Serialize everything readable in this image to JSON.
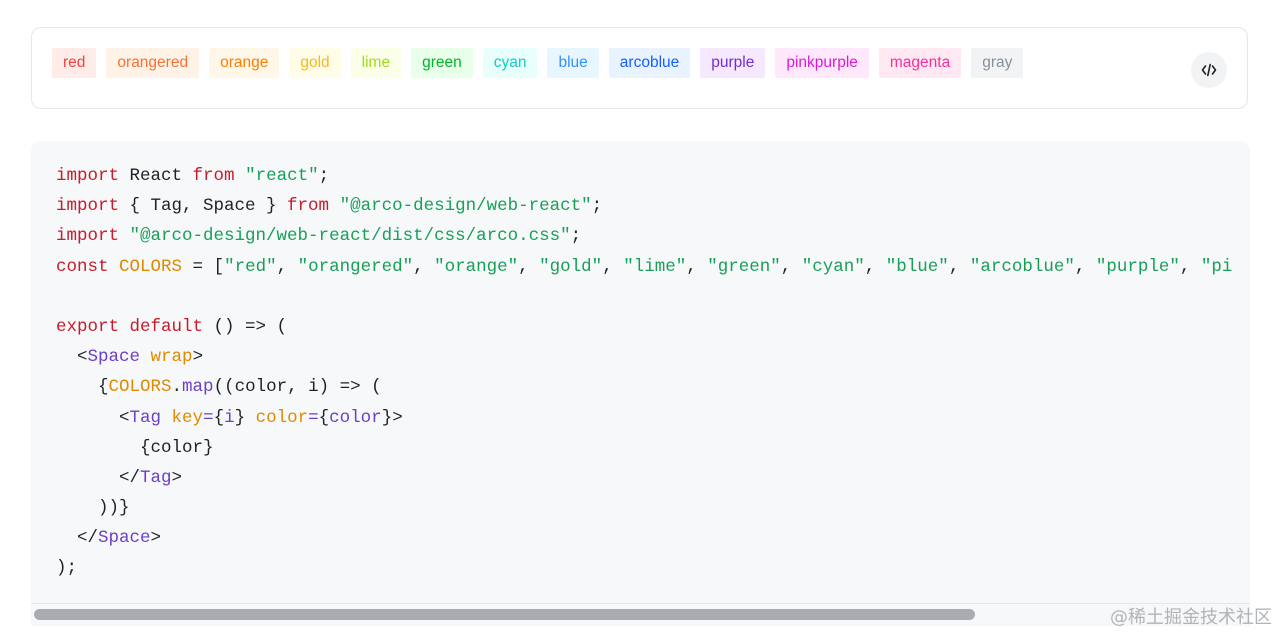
{
  "tags": [
    {
      "label": "red",
      "color": "#f53f3f",
      "bg": "#ffece8"
    },
    {
      "label": "orangered",
      "color": "#f77234",
      "bg": "#fff3e8"
    },
    {
      "label": "orange",
      "color": "#ff7d00",
      "bg": "#fff7e8"
    },
    {
      "label": "gold",
      "color": "#f7ba1e",
      "bg": "#fffce8"
    },
    {
      "label": "lime",
      "color": "#9fdb1d",
      "bg": "#fcffe8"
    },
    {
      "label": "green",
      "color": "#00b42a",
      "bg": "#e8ffea"
    },
    {
      "label": "cyan",
      "color": "#14c9c9",
      "bg": "#e8fffb"
    },
    {
      "label": "blue",
      "color": "#3491fa",
      "bg": "#e8f7ff"
    },
    {
      "label": "arcoblue",
      "color": "#165dff",
      "bg": "#e8f3ff"
    },
    {
      "label": "purple",
      "color": "#722ed1",
      "bg": "#f5e8ff"
    },
    {
      "label": "pinkpurple",
      "color": "#d91ad9",
      "bg": "#ffe8fb"
    },
    {
      "label": "magenta",
      "color": "#f5319d",
      "bg": "#ffe8f1"
    },
    {
      "label": "gray",
      "color": "#86909c",
      "bg": "#f2f3f5"
    }
  ],
  "code_toggle": {
    "icon": "code-icon"
  },
  "code_lines": [
    [
      [
        "k",
        "import"
      ],
      [
        "p",
        " React "
      ],
      [
        "k",
        "from"
      ],
      [
        "p",
        " "
      ],
      [
        "s",
        "\"react\""
      ],
      [
        "p",
        ";"
      ]
    ],
    [
      [
        "k",
        "import"
      ],
      [
        "p",
        " { Tag, Space } "
      ],
      [
        "k",
        "from"
      ],
      [
        "p",
        " "
      ],
      [
        "s",
        "\"@arco-design/web-react\""
      ],
      [
        "p",
        ";"
      ]
    ],
    [
      [
        "k",
        "import"
      ],
      [
        "p",
        " "
      ],
      [
        "s",
        "\"@arco-design/web-react/dist/css/arco.css\""
      ],
      [
        "p",
        ";"
      ]
    ],
    [
      [
        "k",
        "const"
      ],
      [
        "p",
        " "
      ],
      [
        "o",
        "COLORS"
      ],
      [
        "p",
        " = ["
      ],
      [
        "s",
        "\"red\""
      ],
      [
        "p",
        ", "
      ],
      [
        "s",
        "\"orangered\""
      ],
      [
        "p",
        ", "
      ],
      [
        "s",
        "\"orange\""
      ],
      [
        "p",
        ", "
      ],
      [
        "s",
        "\"gold\""
      ],
      [
        "p",
        ", "
      ],
      [
        "s",
        "\"lime\""
      ],
      [
        "p",
        ", "
      ],
      [
        "s",
        "\"green\""
      ],
      [
        "p",
        ", "
      ],
      [
        "s",
        "\"cyan\""
      ],
      [
        "p",
        ", "
      ],
      [
        "s",
        "\"blue\""
      ],
      [
        "p",
        ", "
      ],
      [
        "s",
        "\"arcoblue\""
      ],
      [
        "p",
        ", "
      ],
      [
        "s",
        "\"purple\""
      ],
      [
        "p",
        ", "
      ],
      [
        "s",
        "\"pi"
      ]
    ],
    [],
    [
      [
        "k",
        "export"
      ],
      [
        "p",
        " "
      ],
      [
        "k",
        "default"
      ],
      [
        "p",
        " () => ("
      ]
    ],
    [
      [
        "p",
        "  <"
      ],
      [
        "t",
        "Space"
      ],
      [
        "p",
        " "
      ],
      [
        "o",
        "wrap"
      ],
      [
        "p",
        ">"
      ]
    ],
    [
      [
        "p",
        "    {"
      ],
      [
        "o",
        "COLORS"
      ],
      [
        "p",
        "."
      ],
      [
        "t",
        "map"
      ],
      [
        "p",
        "((color, i) => ("
      ]
    ],
    [
      [
        "p",
        "      <"
      ],
      [
        "t",
        "Tag"
      ],
      [
        "p",
        " "
      ],
      [
        "o",
        "key"
      ],
      [
        "t",
        "="
      ],
      [
        "p",
        "{"
      ],
      [
        "t",
        "i"
      ],
      [
        "p",
        "} "
      ],
      [
        "o",
        "color"
      ],
      [
        "t",
        "="
      ],
      [
        "p",
        "{"
      ],
      [
        "t",
        "color"
      ],
      [
        "p",
        "}>"
      ]
    ],
    [
      [
        "p",
        "        {color}"
      ]
    ],
    [
      [
        "p",
        "      </"
      ],
      [
        "t",
        "Tag"
      ],
      [
        "p",
        ">"
      ]
    ],
    [
      [
        "p",
        "    ))}"
      ]
    ],
    [
      [
        "p",
        "  </"
      ],
      [
        "t",
        "Space"
      ],
      [
        "p",
        ">"
      ]
    ],
    [
      [
        "p",
        ");"
      ]
    ]
  ],
  "scrollbar": {
    "position": 0.77
  },
  "watermark": "@稀土掘金技术社区"
}
